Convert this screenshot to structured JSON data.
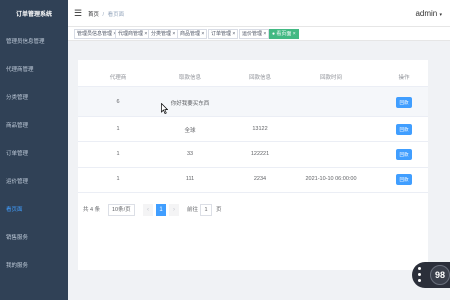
{
  "app": {
    "title": "订单管理系统"
  },
  "sidebar": {
    "items": [
      {
        "label": "管理员信息管理"
      },
      {
        "label": "代理商管理"
      },
      {
        "label": "分类管理"
      },
      {
        "label": "商品管理"
      },
      {
        "label": "订单管理"
      },
      {
        "label": "运价管理"
      },
      {
        "label": "看页面"
      },
      {
        "label": "销售服务"
      },
      {
        "label": "我的服务"
      }
    ]
  },
  "header": {
    "breadcrumb": {
      "home": "首页",
      "separator": "/",
      "current": "看页面"
    },
    "user": "admin",
    "user_caret": "▾",
    "menu_icon": "☰"
  },
  "tags": [
    {
      "label": "管理员信息管理 ×"
    },
    {
      "label": "代理商管理 ×"
    },
    {
      "label": "分类管理 ×"
    },
    {
      "label": "商品管理 ×"
    },
    {
      "label": "订单管理 ×"
    },
    {
      "label": "运价管理 ×"
    },
    {
      "label": "● 看页面 ×"
    }
  ],
  "table": {
    "columns": [
      "代理商",
      "取款信息",
      "回款信息",
      "回款时间",
      "操作"
    ],
    "rows": [
      {
        "agent": "6",
        "withdraw": "你好我要买东西",
        "refund": "",
        "time": "",
        "op": "回款"
      },
      {
        "agent": "1",
        "withdraw": "全球",
        "refund": "13122",
        "time": "",
        "op": "回款"
      },
      {
        "agent": "1",
        "withdraw": "33",
        "refund": "122221",
        "time": "",
        "op": "回款"
      },
      {
        "agent": "1",
        "withdraw": "111",
        "refund": "2234",
        "time": "2021-10-10 06:00:00",
        "op": "回款"
      }
    ]
  },
  "pagination": {
    "total": "共 4 条",
    "page_size": "10条/页",
    "prev": "‹",
    "page": "1",
    "next": "›",
    "goto_label": "前往",
    "goto_value": "1",
    "goto_suffix": "页"
  },
  "monitor": {
    "value": "98"
  },
  "colors": {
    "sidebar_bg": "#304156",
    "sidebar_active": "#409eff",
    "primary": "#409eff",
    "tag_active": "#42b983"
  }
}
